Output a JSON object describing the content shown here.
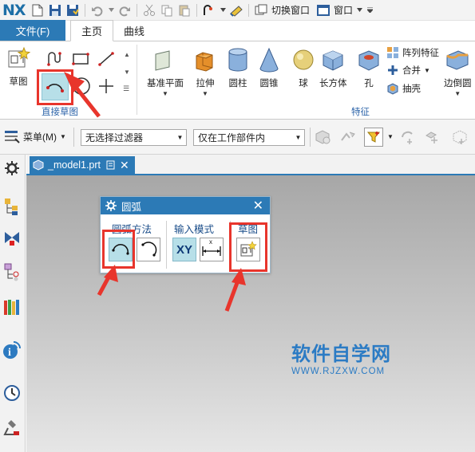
{
  "app": {
    "logo": "NX"
  },
  "quick_access": {
    "switch_window_label": "切换窗口",
    "window_label": "窗口",
    "icons": [
      "new-file-icon",
      "save-icon",
      "save-all-icon",
      "undo-icon",
      "redo-icon",
      "cut-icon",
      "copy-icon",
      "paste-icon",
      "command-finder-icon",
      "touch-mode-icon",
      "switch-window-icon",
      "window-icon"
    ]
  },
  "tabs": {
    "file": "文件(F)",
    "home": "主页",
    "curve": "曲线"
  },
  "ribbon": {
    "sketch_group": {
      "sketch_label": "草图",
      "group_label": "直接草图",
      "tools": [
        "profile-icon",
        "rectangle-icon",
        "line-icon",
        "arc-icon",
        "circle-icon",
        "point-icon"
      ]
    },
    "feature_group": {
      "group_label": "特征",
      "datum_plane": "基准平面",
      "extrude": "拉伸",
      "cylinder": "圆柱",
      "cone": "圆锥",
      "sphere": "球",
      "block": "长方体",
      "hole": "孔",
      "pattern_feature": "阵列特征",
      "unite": "合并",
      "shell": "抽壳",
      "edge_blend": "边倒圆"
    }
  },
  "selection_bar": {
    "menu_label": "菜单(M)",
    "type_filter": "无选择过滤器",
    "scope_filter": "仅在工作部件内"
  },
  "document": {
    "tab_name": "_model1.prt"
  },
  "arc_dialog": {
    "title": "圆弧",
    "method_label": "圆弧方法",
    "input_mode_label": "输入模式",
    "sketch_label": "草图",
    "xy_label": "XY",
    "parameter_mode_label": "x"
  },
  "watermark": {
    "main": "软件自学网",
    "sub": "WWW.RJZXW.COM"
  },
  "colors": {
    "accent": "#2c7ab6",
    "highlight": "#e8352c",
    "canvas_top": "#a7a7a7",
    "canvas_bottom": "#e6e6e6"
  }
}
